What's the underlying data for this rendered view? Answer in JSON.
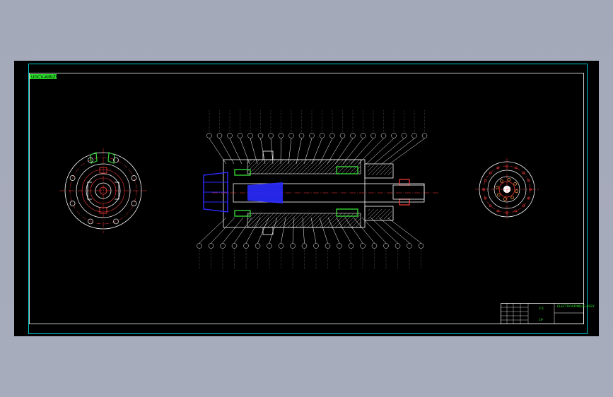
{
  "drawing": {
    "tag_label": "UGCV-AIBIZ9",
    "title_block": {
      "scale": "2:1",
      "sheet": "19",
      "name": "ELECTROSPINDLE-ASSY"
    },
    "colors": {
      "background": "#000000",
      "border": "#00c8c8",
      "frame": "#ffffff",
      "section": "#ff3b3b",
      "seal": "#35d035",
      "shaft": "#2a2aff",
      "hatch": "#dddddd"
    },
    "top_callouts": 22,
    "bottom_callouts": 20
  }
}
